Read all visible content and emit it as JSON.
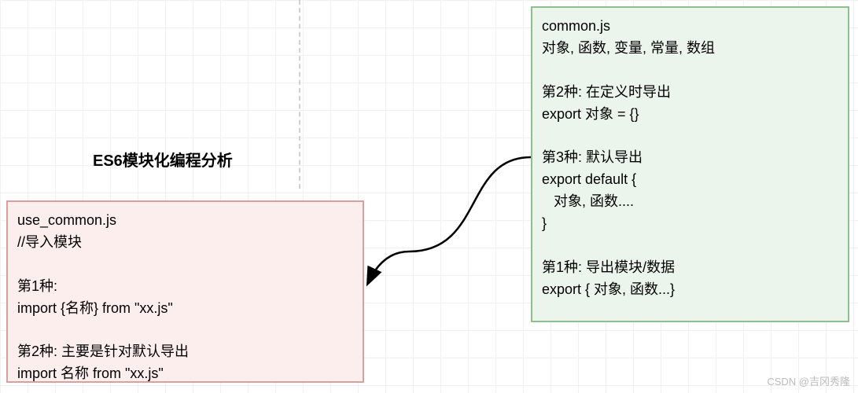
{
  "title": "ES6模块化编程分析",
  "leftBox": {
    "line1": "use_common.js",
    "line2": "//导入模块",
    "line3": "第1种:",
    "line4": "import {名称} from \"xx.js\"",
    "line5": "第2种: 主要是针对默认导出",
    "line6": "import 名称 from \"xx.js\""
  },
  "rightBox": {
    "line1": "common.js",
    "line2": "对象, 函数, 变量, 常量, 数组",
    "line3": "第2种: 在定义时导出",
    "line4": "export 对象 = {}",
    "line5": "第3种: 默认导出",
    "line6": "export default {",
    "line7": "   对象,  函数....",
    "line8": "}",
    "line9": "第1种:  导出模块/数据",
    "line10": "export { 对象,  函数...}"
  },
  "watermark": "CSDN @吉冈秀隆"
}
